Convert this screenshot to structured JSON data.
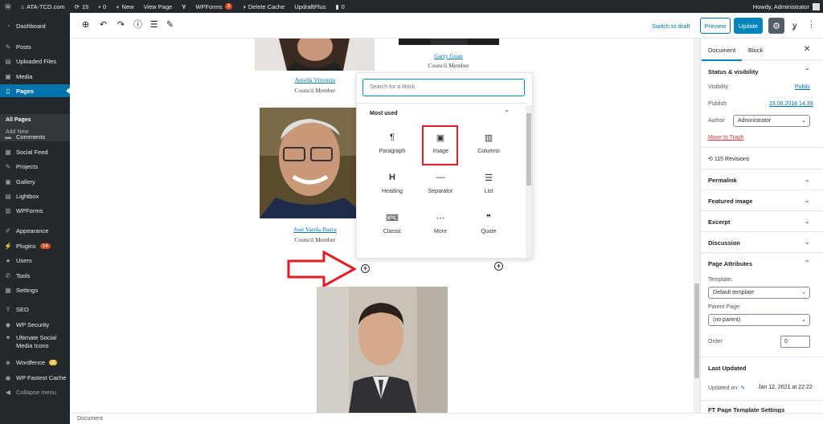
{
  "admin_bar": {
    "site_name": "ATA-TCD.com",
    "updates_count": "15",
    "comments_count": "0",
    "new_label": "New",
    "view_page_label": "View Page",
    "wpforms_label": "WPForms",
    "wpforms_badge": "3",
    "delete_cache_label": "Delete Cache",
    "updraft_label": "UpdraftPlus",
    "notif_count": "0",
    "howdy": "Howdy, Administrator"
  },
  "menu": {
    "items": [
      {
        "label": "Dashboard",
        "icon": "dashboard-icon"
      },
      {
        "label": "Posts",
        "icon": "pin-icon"
      },
      {
        "label": "Uploaded Files",
        "icon": "files-icon"
      },
      {
        "label": "Media",
        "icon": "media-icon"
      },
      {
        "label": "Pages",
        "icon": "pages-icon"
      },
      {
        "label": "Comments",
        "icon": "comments-icon"
      },
      {
        "label": "Social Feed",
        "icon": "feed-icon"
      },
      {
        "label": "Projects",
        "icon": "pin-icon"
      },
      {
        "label": "Gallery",
        "icon": "gallery-icon"
      },
      {
        "label": "Lightbox",
        "icon": "lightbox-icon"
      },
      {
        "label": "WPForms",
        "icon": "forms-icon"
      },
      {
        "label": "Appearance",
        "icon": "brush-icon"
      },
      {
        "label": "Plugins",
        "icon": "plugin-icon",
        "badge": "14"
      },
      {
        "label": "Users",
        "icon": "users-icon"
      },
      {
        "label": "Tools",
        "icon": "tools-icon"
      },
      {
        "label": "Settings",
        "icon": "settings-icon"
      },
      {
        "label": "SEO",
        "icon": "seo-icon"
      },
      {
        "label": "WP Security",
        "icon": "shield-icon"
      },
      {
        "label": "Ultimate Social",
        "label2": "Media Icons",
        "icon": "social-icon"
      },
      {
        "label": "Wordfence",
        "icon": "wordfence-icon",
        "badge": "2"
      },
      {
        "label": "WP Fastest Cache",
        "icon": "cache-icon"
      },
      {
        "label": "Collapse menu",
        "icon": "collapse-icon"
      }
    ],
    "submenu": {
      "all_pages": "All Pages",
      "add_new": "Add New"
    }
  },
  "toolbar": {
    "switch_to_draft": "Switch to draft",
    "preview": "Preview",
    "update": "Update"
  },
  "canvas": {
    "people": [
      {
        "name": "Aniella Vivenzio",
        "role": "Council Member"
      },
      {
        "name": "Garry Guan",
        "role": "Council Member"
      },
      {
        "name": "Jose Varela Ibarra",
        "role": "Council Member"
      }
    ]
  },
  "inserter": {
    "search_placeholder": "Search for a block",
    "section_title": "Most used",
    "blocks": [
      {
        "label": "Paragraph",
        "icon": "paragraph-icon",
        "glyph": "¶"
      },
      {
        "label": "Image",
        "icon": "image-icon",
        "glyph": "▣"
      },
      {
        "label": "Columns",
        "icon": "columns-icon",
        "glyph": "▥"
      },
      {
        "label": "Heading",
        "icon": "heading-icon",
        "glyph": "H"
      },
      {
        "label": "Separator",
        "icon": "separator-icon",
        "glyph": "—"
      },
      {
        "label": "List",
        "icon": "list-icon",
        "glyph": "☰"
      },
      {
        "label": "Classic",
        "icon": "classic-icon",
        "glyph": "⌨"
      },
      {
        "label": "More",
        "icon": "more-icon",
        "glyph": "⋯"
      },
      {
        "label": "Quote",
        "icon": "quote-icon",
        "glyph": "❞"
      }
    ]
  },
  "sidebar": {
    "tab_document": "Document",
    "tab_block": "Block",
    "status_title": "Status & visibility",
    "visibility_label": "Visibility",
    "visibility_value": "Public",
    "publish_label": "Publish",
    "publish_value": "29.06.2018 14:39",
    "author_label": "Author",
    "author_value": "Administrator",
    "move_to_trash": "Move to Trash",
    "revisions": "115 Revisions",
    "permalink": "Permalink",
    "featured_image": "Featured image",
    "excerpt": "Excerpt",
    "discussion": "Discussion",
    "page_attributes": "Page Attributes",
    "template_label": "Template:",
    "template_value": "Default template",
    "parent_label": "Parent Page:",
    "parent_value": "(no parent)",
    "order_label": "Order",
    "order_value": "0",
    "last_updated": "Last Updated",
    "updated_on_label": "Updated on:",
    "updated_on_value": "Jan 12, 2021 at 22:22",
    "ft_settings": "FT Page Template Settings"
  },
  "footer": {
    "label": "Document"
  },
  "colors": {
    "accent": "#0085ba",
    "admin_bar": "#23282d",
    "highlight": "#e21d24"
  }
}
